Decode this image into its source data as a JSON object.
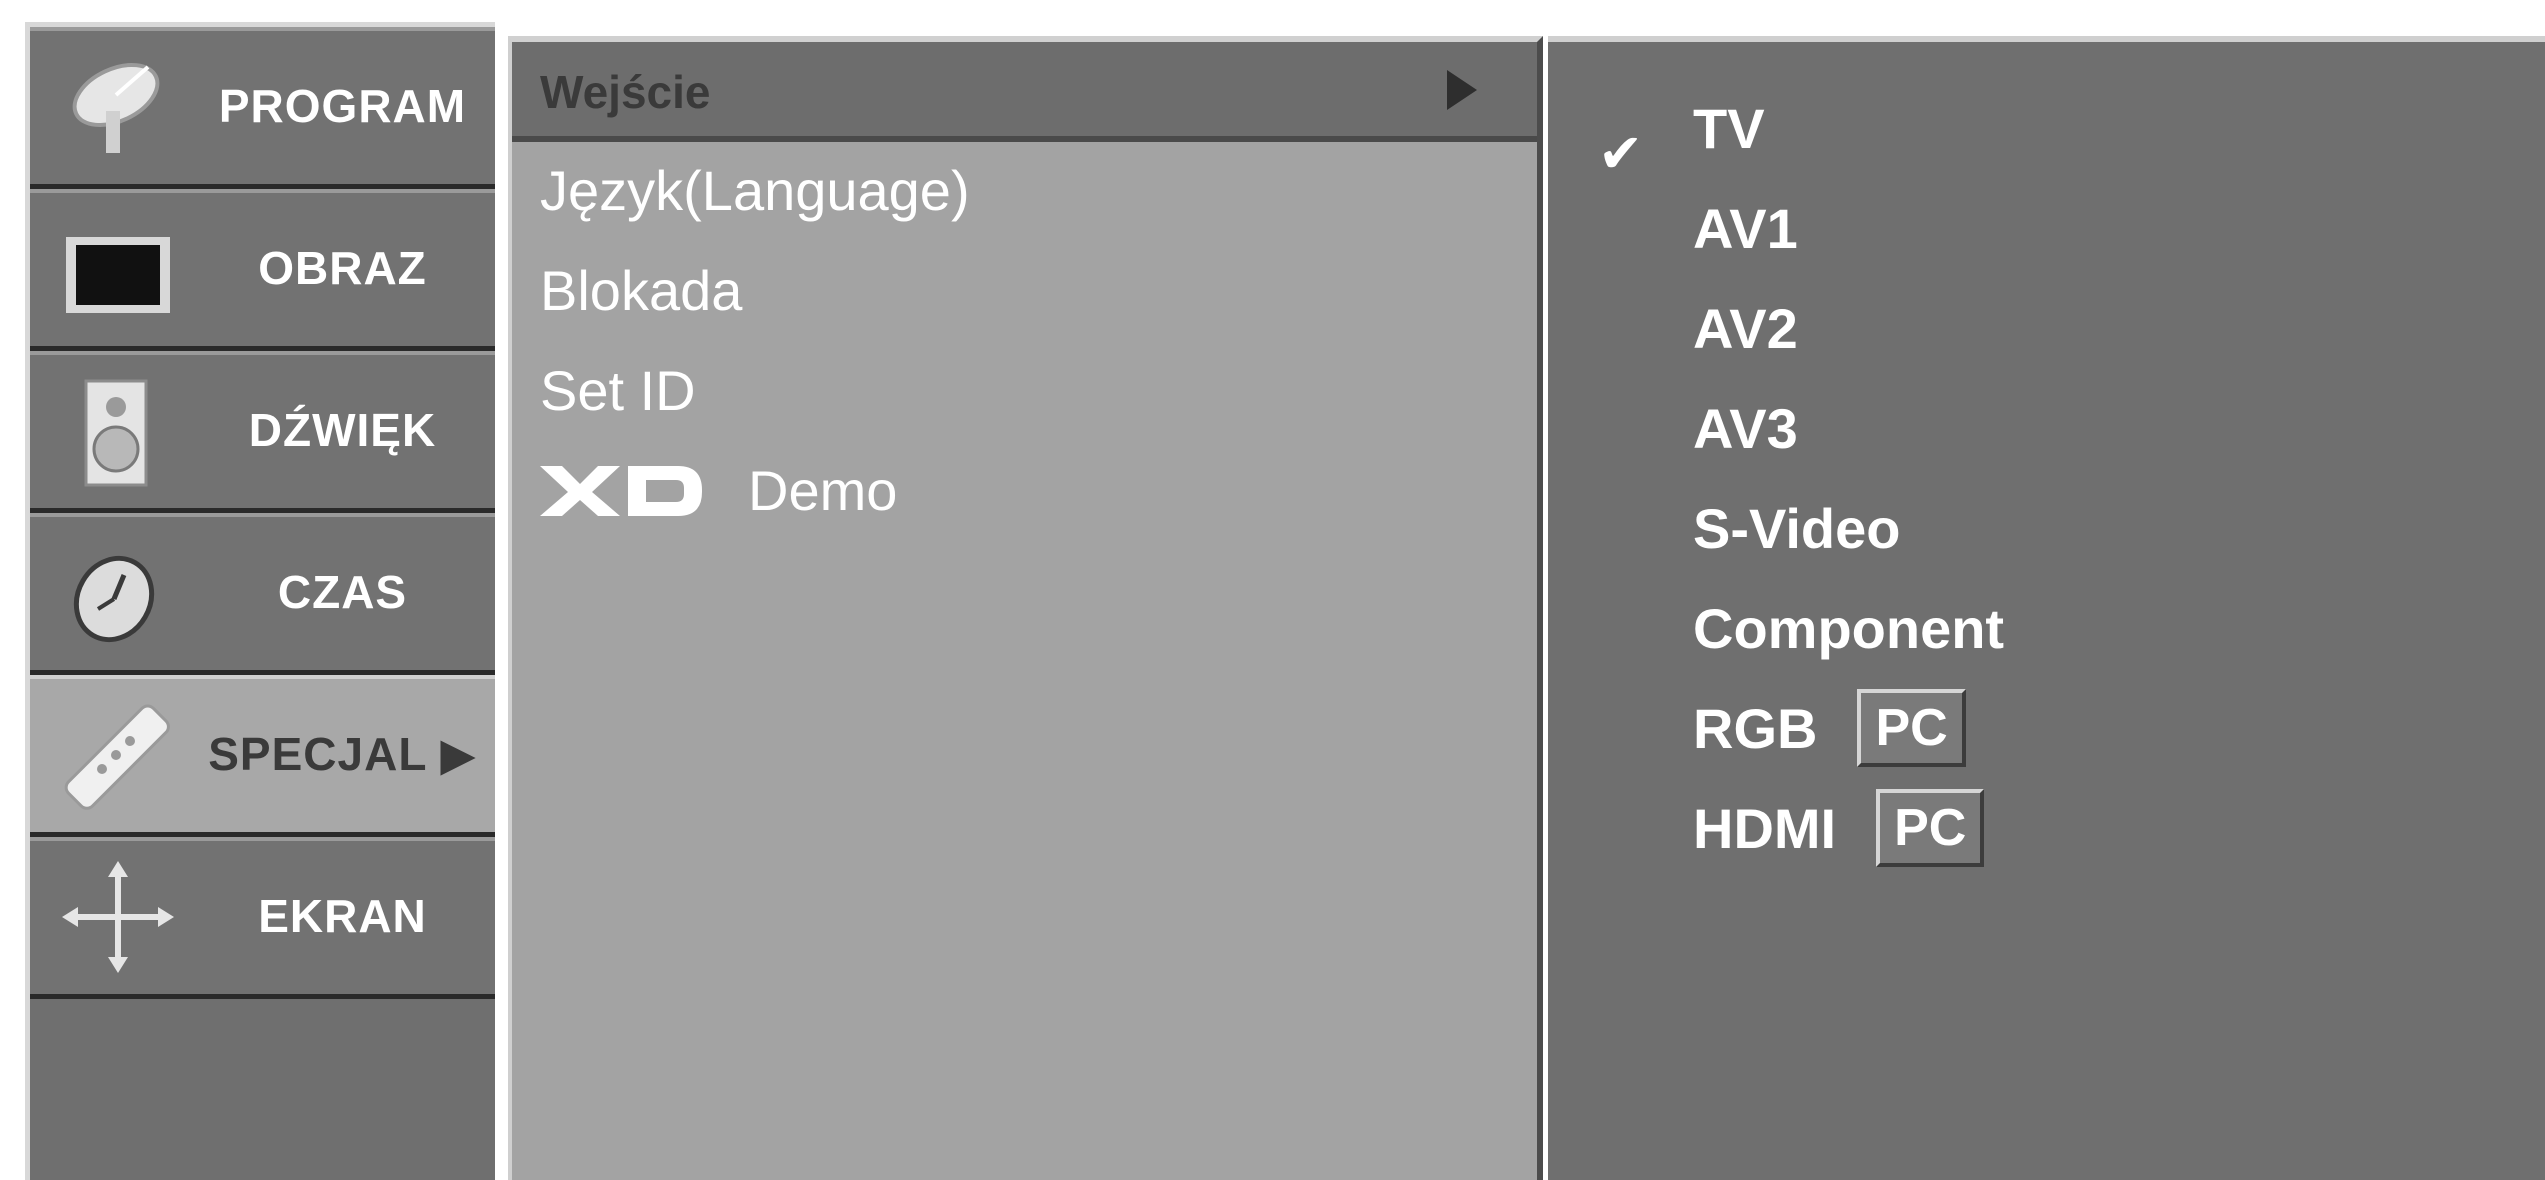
{
  "sidebar": {
    "items": [
      {
        "label": "PROGRAM",
        "icon": "satellite-dish-icon"
      },
      {
        "label": "OBRAZ",
        "icon": "tv-screen-icon"
      },
      {
        "label": "DŹWIĘK",
        "icon": "speaker-icon"
      },
      {
        "label": "CZAS",
        "icon": "clock-icon"
      },
      {
        "label": "SPECJAL ▶",
        "icon": "remote-control-icon",
        "selected": true
      },
      {
        "label": "EKRAN",
        "icon": "move-arrows-icon"
      }
    ]
  },
  "submenu": {
    "items": [
      {
        "label": "Wejście",
        "highlighted": true
      },
      {
        "label": "Język(Language)"
      },
      {
        "label": "Blokada"
      },
      {
        "label": "Set ID"
      },
      {
        "label": "Demo",
        "logo": "XD"
      }
    ],
    "arrow": "▶"
  },
  "options": {
    "checkmark": "✔",
    "items": [
      {
        "label": "TV",
        "checked": true
      },
      {
        "label": "AV1"
      },
      {
        "label": "AV2"
      },
      {
        "label": "AV3"
      },
      {
        "label": "S-Video"
      },
      {
        "label": "Component"
      },
      {
        "label": "RGB",
        "tag": "PC"
      },
      {
        "label": "HDMI",
        "tag": "PC"
      }
    ]
  },
  "colors": {
    "panel_dark": "#6f6f6f",
    "panel_light": "#a3a3a3",
    "text": "#ffffff"
  }
}
